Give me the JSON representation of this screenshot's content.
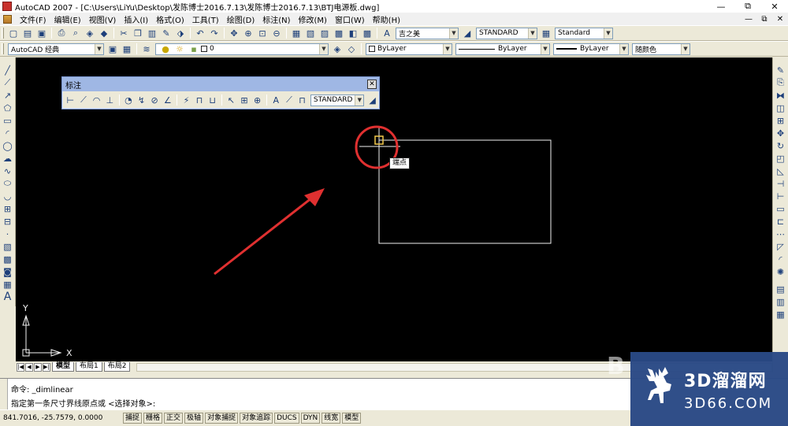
{
  "window": {
    "title": "AutoCAD 2007 - [C:\\Users\\LiYu\\Desktop\\发陈博士2016.7.13\\发陈博士2016.7.13\\BTJ电源板.dwg]",
    "min": "—",
    "max": "⧉",
    "close": "✕"
  },
  "menu": {
    "items": [
      "文件(F)",
      "编辑(E)",
      "视图(V)",
      "插入(I)",
      "格式(O)",
      "工具(T)",
      "绘图(D)",
      "标注(N)",
      "修改(M)",
      "窗口(W)",
      "帮助(H)"
    ],
    "doc_min": "—",
    "doc_max": "⧉",
    "doc_close": "✕"
  },
  "toolbar1": {
    "text_style": "吉之美",
    "dim_style": "STANDARD",
    "table_style": "Standard"
  },
  "toolbar2": {
    "workspace": "AutoCAD 经典",
    "layer": "0",
    "color": "ByLayer",
    "linetype": "ByLayer",
    "lineweight": "ByLayer",
    "plotstyle": "随颜色"
  },
  "dim_toolbar": {
    "title": "标注",
    "style": "STANDARD",
    "close": "✕"
  },
  "canvas": {
    "tooltip": "端点",
    "ucs_x": "X",
    "ucs_y": "Y"
  },
  "layout_tabs": {
    "tabs": [
      "模型",
      "布局1",
      "布局2"
    ],
    "nav": [
      "|◀",
      "◀",
      "▶",
      "▶|"
    ]
  },
  "command": {
    "line1": "命令: _dimlinear",
    "line2": "指定第一条尺寸界线原点或 <选择对象>:"
  },
  "status": {
    "coords": "841.7016,  -25.7579, 0.0000",
    "buttons": [
      "捕捉",
      "栅格",
      "正交",
      "极轴",
      "对象捕捉",
      "对象追踪",
      "DUCS",
      "DYN",
      "线宽",
      "模型"
    ]
  },
  "watermark": {
    "title": "3D溜溜网",
    "url": "3D66.COM",
    "ghost": "B"
  },
  "colors": {
    "canvas_bg": "#000000",
    "annotation_red": "#e03030",
    "chrome": "#ECE9D8",
    "watermark_bg": "#2a4a86"
  }
}
